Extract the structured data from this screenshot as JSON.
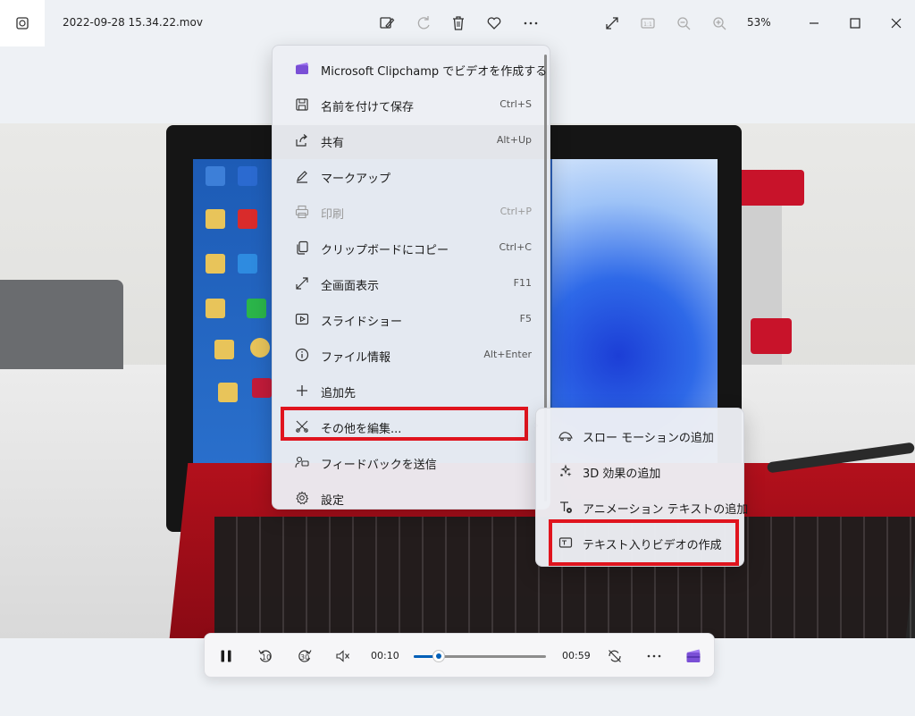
{
  "titlebar": {
    "filename": "2022-09-28 15.34.22.mov",
    "zoom_level": "53%",
    "toolbar_icons": [
      "edit-image-icon",
      "rotate-icon",
      "delete-icon",
      "favorite-icon",
      "more-icon",
      "fullscreen-icon",
      "actual-size-icon",
      "zoom-out-icon",
      "zoom-in-icon"
    ],
    "window_buttons": [
      "minimize-icon",
      "maximize-icon",
      "close-icon"
    ]
  },
  "menu": {
    "items": [
      {
        "label": "Microsoft Clipchamp でビデオを作成する",
        "shortcut": "",
        "icon": "clipchamp-icon",
        "disabled": false
      },
      {
        "label": "名前を付けて保存",
        "shortcut": "Ctrl+S",
        "icon": "save-icon",
        "disabled": false
      },
      {
        "label": "共有",
        "shortcut": "Alt+Up",
        "icon": "share-icon",
        "disabled": false
      },
      {
        "label": "マークアップ",
        "shortcut": "",
        "icon": "markup-pen-icon",
        "disabled": false
      },
      {
        "label": "印刷",
        "shortcut": "Ctrl+P",
        "icon": "print-icon",
        "disabled": true
      },
      {
        "label": "クリップボードにコピー",
        "shortcut": "Ctrl+C",
        "icon": "copy-icon",
        "disabled": false
      },
      {
        "label": "全画面表示",
        "shortcut": "F11",
        "icon": "fullscreen-icon",
        "disabled": false
      },
      {
        "label": "スライドショー",
        "shortcut": "F5",
        "icon": "slideshow-icon",
        "disabled": false
      },
      {
        "label": "ファイル情報",
        "shortcut": "Alt+Enter",
        "icon": "info-icon",
        "disabled": false
      },
      {
        "label": "追加先",
        "shortcut": "",
        "icon": "add-icon",
        "disabled": false
      },
      {
        "label": "その他を編集...",
        "shortcut": "",
        "icon": "edit-more-icon",
        "disabled": false,
        "submenu": true
      },
      {
        "label": "フィードバックを送信",
        "shortcut": "",
        "icon": "feedback-icon",
        "disabled": false
      },
      {
        "label": "設定",
        "shortcut": "",
        "icon": "settings-gear-icon",
        "disabled": false
      }
    ]
  },
  "submenu": {
    "items": [
      {
        "label": "スロー モーションの追加",
        "icon": "slow-motion-icon"
      },
      {
        "label": "3D 効果の追加",
        "icon": "3d-effects-icon"
      },
      {
        "label": "アニメーション テキストの追加",
        "icon": "animated-text-icon"
      },
      {
        "label": "テキスト入りビデオの作成",
        "icon": "video-with-text-icon"
      }
    ]
  },
  "player": {
    "current_time": "00:10",
    "duration": "00:59",
    "progress": 0.19,
    "buttons": [
      "pause-icon",
      "rewind-10-icon",
      "forward-30-icon",
      "mute-icon",
      "repeat-off-icon",
      "more-icon",
      "clipchamp-icon"
    ],
    "rewind_label": "10",
    "forward_label": "30"
  },
  "colors": {
    "highlight": "#e0141e",
    "accent": "#005fb8"
  }
}
